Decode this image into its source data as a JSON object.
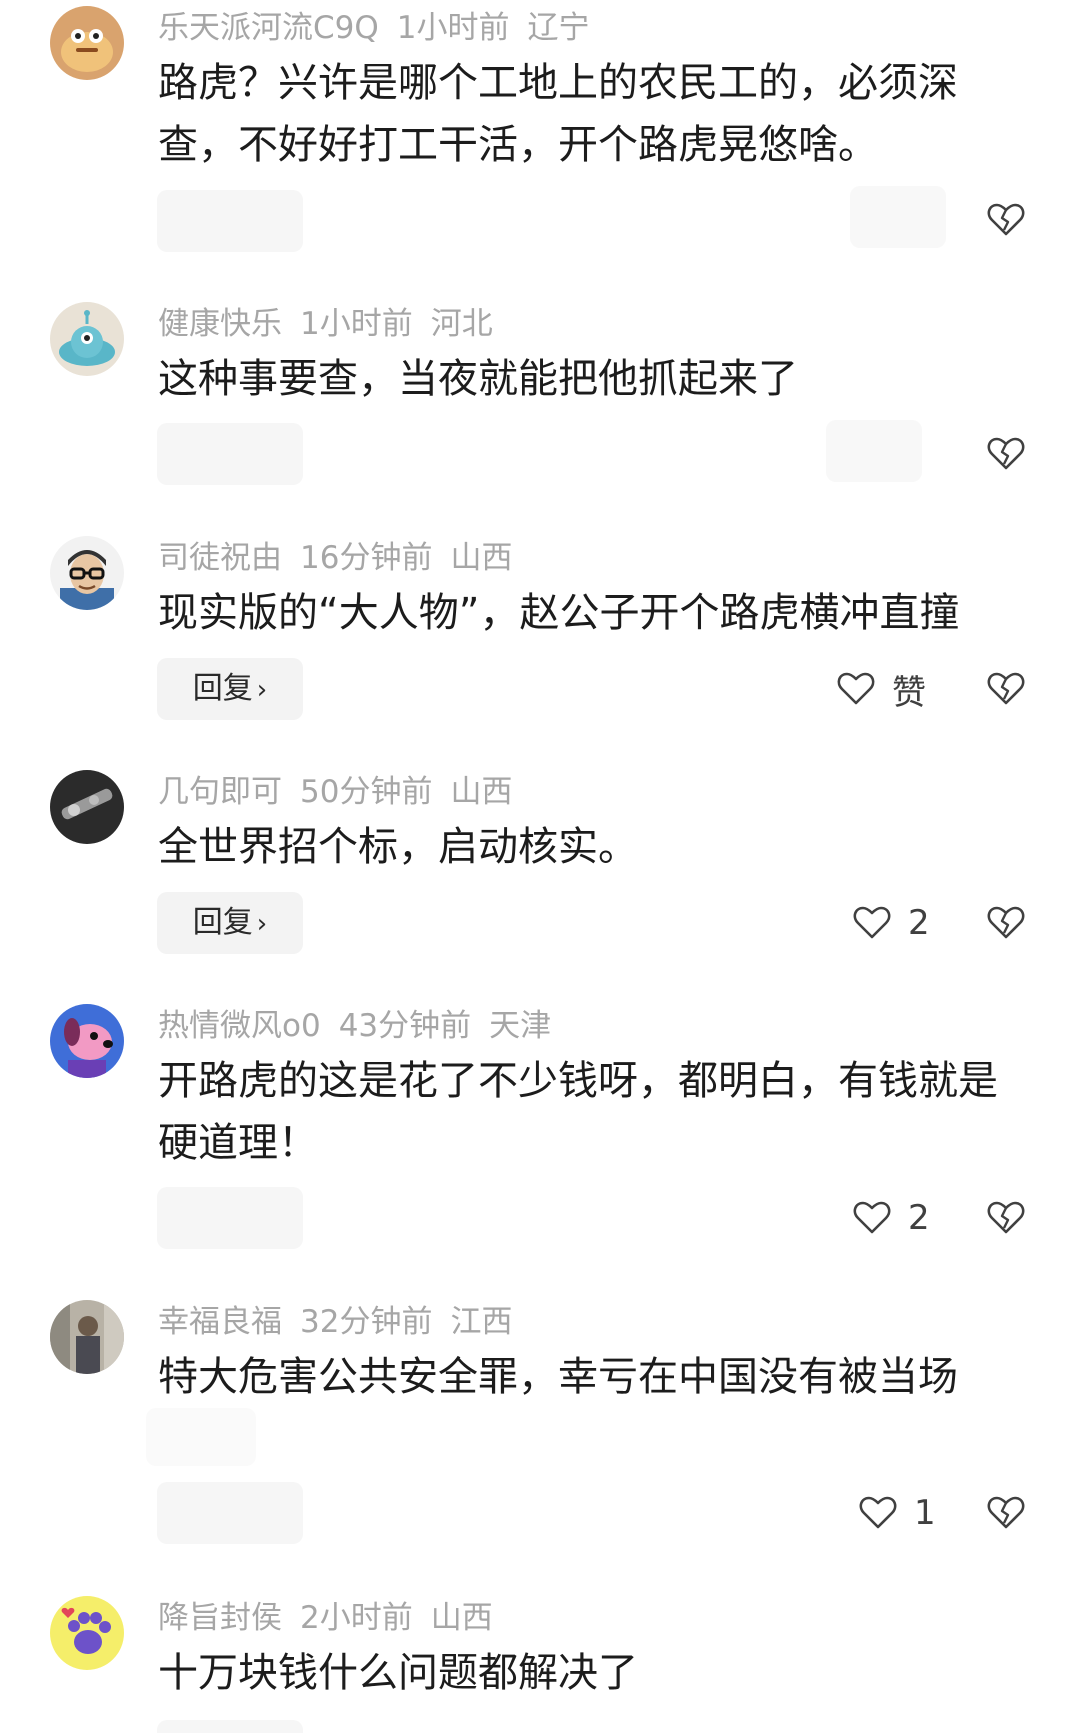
{
  "comments": [
    {
      "username": "乐天派河流C9Q",
      "time": "1小时前",
      "location": "辽宁",
      "text": "路虎？兴许是哪个工地上的农民工的，必须深查，不好好打工干活，开个路虎晃悠啥。",
      "avatar_icon": "cartoon-food-avatar-icon"
    },
    {
      "username": "健康快乐",
      "time": "1小时前",
      "location": "河北",
      "text": "这种事要查，当夜就能把他抓起来了",
      "avatar_icon": "alien-ufo-avatar-icon"
    },
    {
      "username": "司徒祝由",
      "time": "16分钟前",
      "location": "山西",
      "text": "现实版的“大人物”，赵公子开个路虎横冲直撞",
      "reply_label": "回复",
      "like_label": "赞",
      "avatar_icon": "cartoon-man-glasses-avatar-icon"
    },
    {
      "username": "几句即可",
      "time": "50分钟前",
      "location": "山西",
      "text": "全世界招个标，启动核实。",
      "reply_label": "回复",
      "like_count": "2",
      "avatar_icon": "photo-object-avatar-icon"
    },
    {
      "username": "热情微风o0",
      "time": "43分钟前",
      "location": "天津",
      "text": "开路虎的这是花了不少钱呀，都明白，有钱就是硬道理！",
      "like_count": "2",
      "avatar_icon": "pink-dog-avatar-icon"
    },
    {
      "username": "幸福良福",
      "time": "32分钟前",
      "location": "江西",
      "text": "特大危害公共安全罪，幸亏在中国没有被当场",
      "like_count": "1",
      "avatar_icon": "photo-person-avatar-icon"
    },
    {
      "username": "降旨封侯",
      "time": "2小时前",
      "location": "山西",
      "text": "十万块钱什么问题都解决了",
      "avatar_icon": "paw-avatar-icon"
    }
  ],
  "colors": {
    "meta_text": "#a6a6a6",
    "body_text": "#1c1c1c",
    "reply_bg": "#f3f3f3",
    "icon_stroke": "#404040"
  }
}
